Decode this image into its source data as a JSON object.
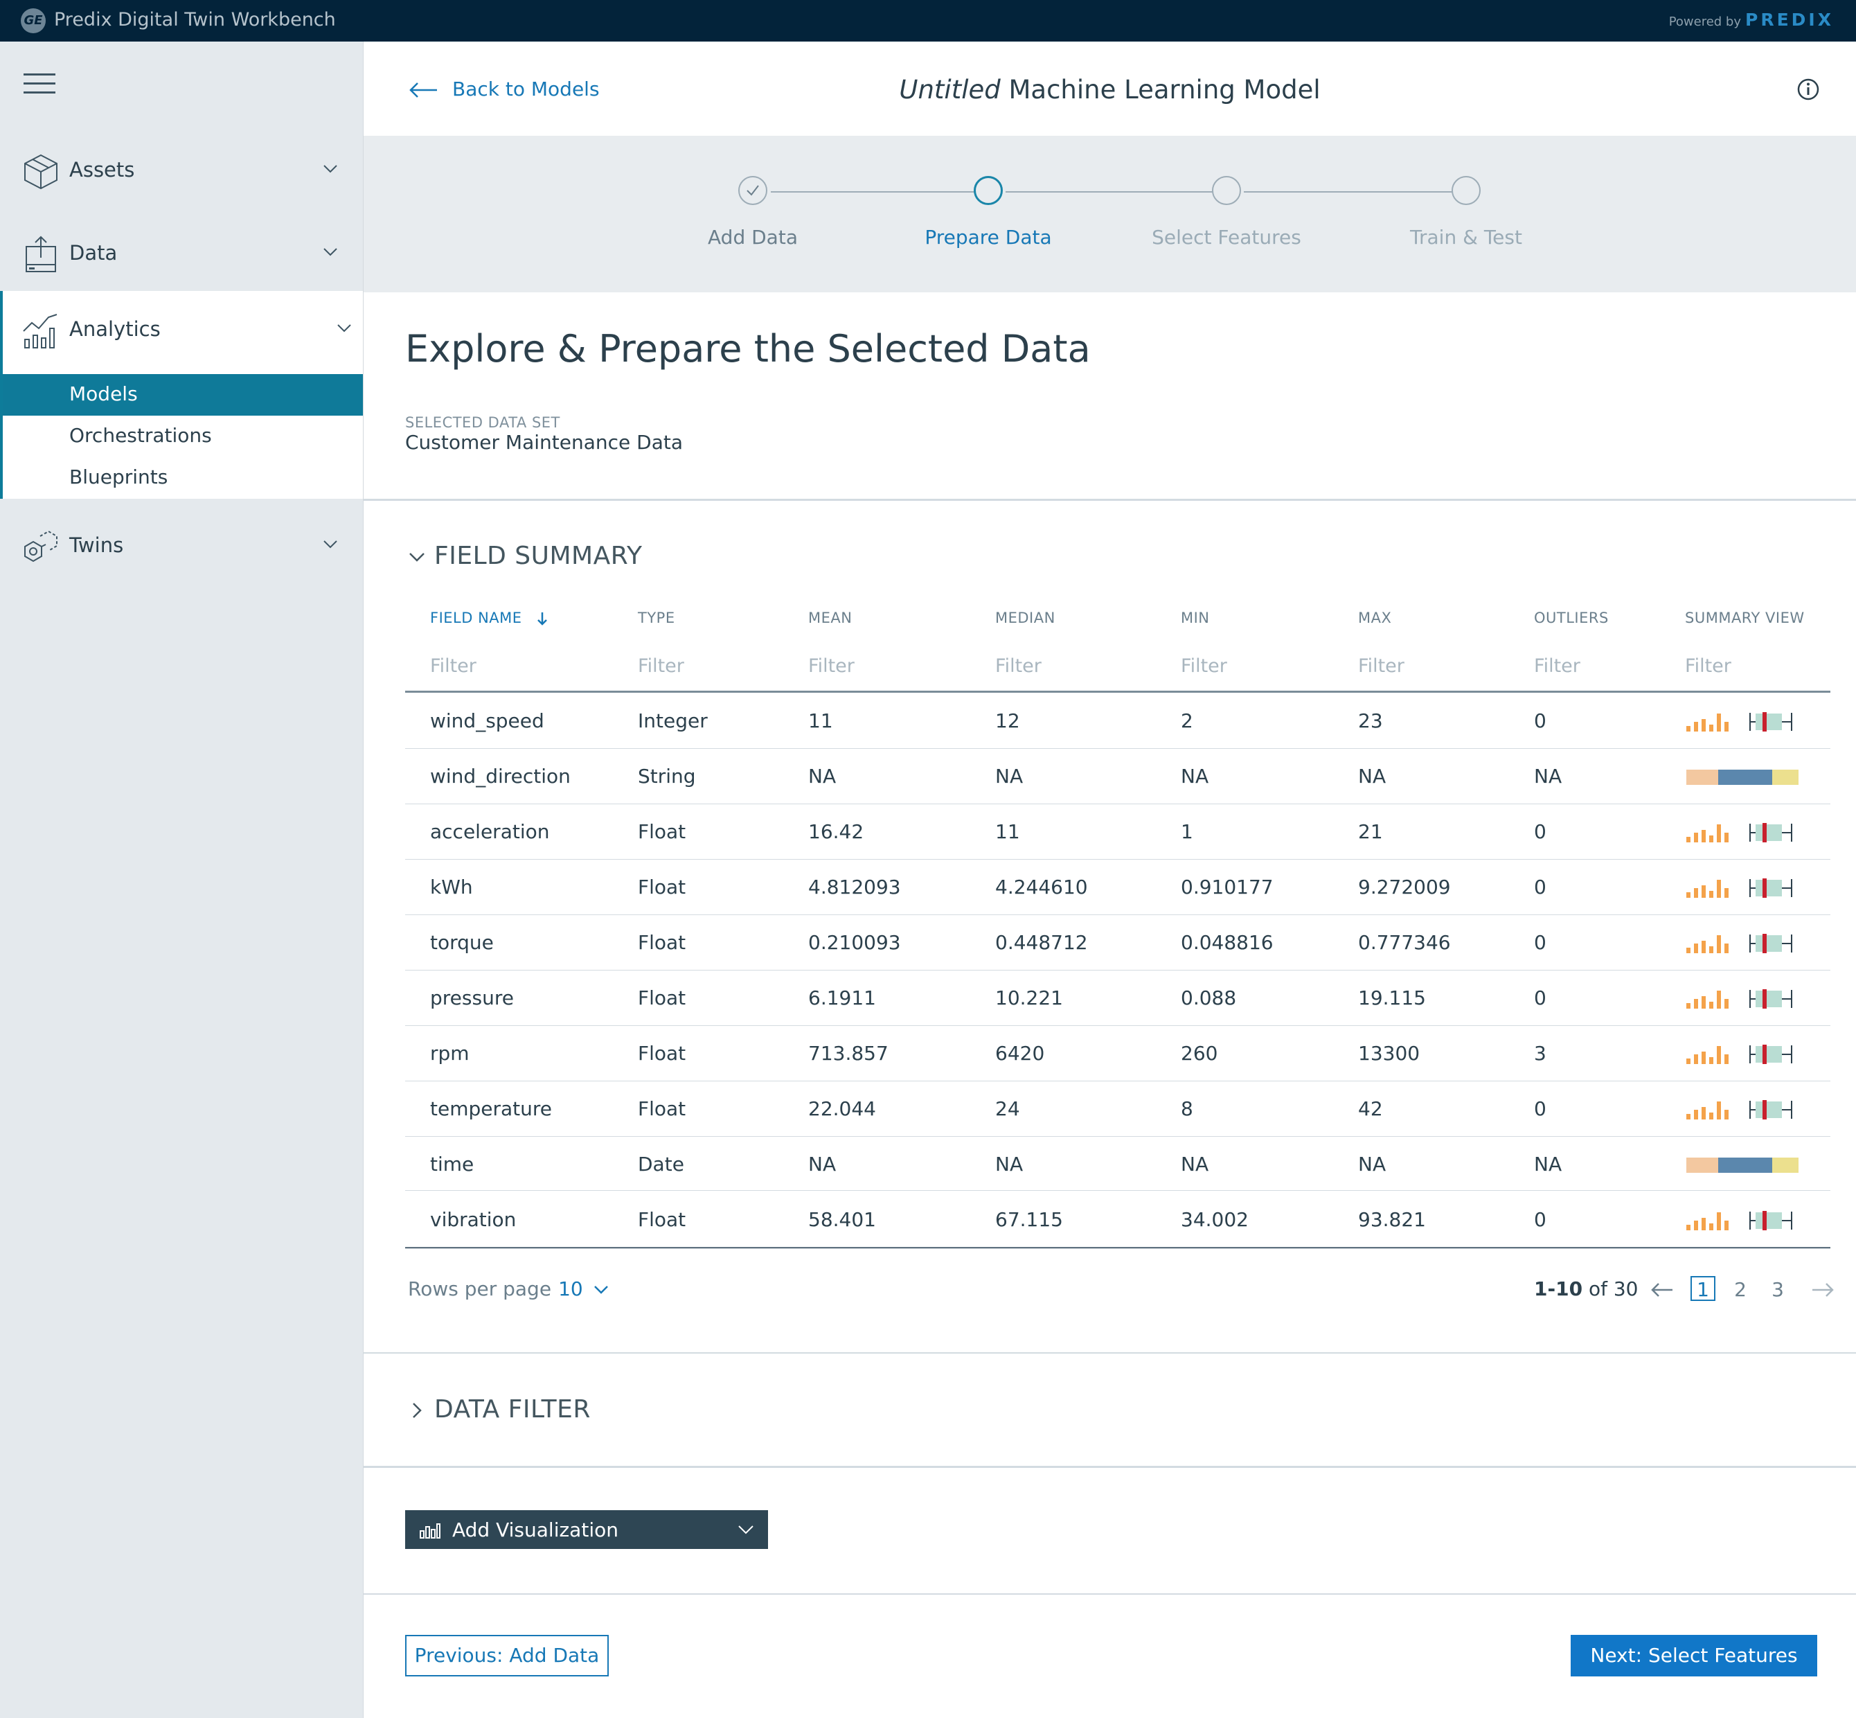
{
  "app": {
    "title": "Predix Digital Twin Workbench",
    "powered_by": "Powered by",
    "brand": "PREDIX",
    "logo_text": "GE"
  },
  "sidebar": {
    "items": [
      {
        "label": "Assets",
        "icon": "cube-icon"
      },
      {
        "label": "Data",
        "icon": "data-upload-icon"
      },
      {
        "label": "Analytics",
        "icon": "analytics-chart-icon"
      },
      {
        "label": "Twins",
        "icon": "hexagon-network-icon"
      }
    ],
    "analytics_sub": [
      {
        "label": "Models",
        "active": true
      },
      {
        "label": "Orchestrations",
        "active": false
      },
      {
        "label": "Blueprints",
        "active": false
      }
    ]
  },
  "header": {
    "back_label": "Back to Models",
    "title_italic": "Untitled",
    "title_rest": " Machine Learning Model"
  },
  "stepper": {
    "steps": [
      {
        "label": "Add Data",
        "state": "done"
      },
      {
        "label": "Prepare Data",
        "state": "active"
      },
      {
        "label": "Select Features",
        "state": "pending"
      },
      {
        "label": "Train & Test",
        "state": "pending"
      }
    ]
  },
  "page": {
    "heading": "Explore & Prepare the Selected Data",
    "dataset_caption": "SELECTED DATA SET",
    "dataset_name": "Customer Maintenance Data"
  },
  "field_summary": {
    "title": "FIELD SUMMARY",
    "columns": [
      "FIELD NAME",
      "TYPE",
      "MEAN",
      "MEDIAN",
      "MIN",
      "MAX",
      "OUTLIERS",
      "SUMMARY VIEW"
    ],
    "filter_placeholder": "Filter",
    "rows": [
      {
        "name": "wind_speed",
        "type": "Integer",
        "mean": "11",
        "median": "12",
        "min": "2",
        "max": "23",
        "outliers": "0",
        "view": "numeric"
      },
      {
        "name": "wind_direction",
        "type": "String",
        "mean": "NA",
        "median": "NA",
        "min": "NA",
        "max": "NA",
        "outliers": "NA",
        "view": "categorical"
      },
      {
        "name": "acceleration",
        "type": "Float",
        "mean": "16.42",
        "median": "11",
        "min": "1",
        "max": "21",
        "outliers": "0",
        "view": "numeric"
      },
      {
        "name": "kWh",
        "type": "Float",
        "mean": "4.812093",
        "median": "4.244610",
        "min": "0.910177",
        "max": "9.272009",
        "outliers": "0",
        "view": "numeric"
      },
      {
        "name": "torque",
        "type": "Float",
        "mean": "0.210093",
        "median": "0.448712",
        "min": "0.048816",
        "max": "0.777346",
        "outliers": "0",
        "view": "numeric"
      },
      {
        "name": "pressure",
        "type": "Float",
        "mean": "6.1911",
        "median": "10.221",
        "min": "0.088",
        "max": "19.115",
        "outliers": "0",
        "view": "numeric"
      },
      {
        "name": "rpm",
        "type": "Float",
        "mean": "713.857",
        "median": "6420",
        "min": "260",
        "max": "13300",
        "outliers": "3",
        "view": "numeric"
      },
      {
        "name": "temperature",
        "type": "Float",
        "mean": "22.044",
        "median": "24",
        "min": "8",
        "max": "42",
        "outliers": "0",
        "view": "numeric"
      },
      {
        "name": "time",
        "type": "Date",
        "mean": "NA",
        "median": "NA",
        "min": "NA",
        "max": "NA",
        "outliers": "NA",
        "view": "categorical"
      },
      {
        "name": "vibration",
        "type": "Float",
        "mean": "58.401",
        "median": "67.115",
        "min": "34.002",
        "max": "93.821",
        "outliers": "0",
        "view": "numeric"
      }
    ],
    "colors": {
      "histogram": "#f4a24a",
      "box_fill": "#b9ddd3",
      "box_median": "#c8202d",
      "whisker": "#2c404c",
      "cat_left": "#f3c8a0",
      "cat_mid": "#5b87ad",
      "cat_right": "#ece08e"
    }
  },
  "pagination": {
    "rows_per_page_label": "Rows per page",
    "rows_per_page_value": "10",
    "range_bold": "1-10",
    "range_rest": " of 30",
    "pages": [
      "1",
      "2",
      "3"
    ],
    "current_page": "1"
  },
  "data_filter": {
    "title": "DATA FILTER"
  },
  "visualization": {
    "label": "Add Visualization"
  },
  "footer": {
    "previous_label": "Previous: Add Data",
    "next_label": "Next: Select Features"
  },
  "colors": {
    "topbar": "#03233a",
    "accent": "#1778b6",
    "active_nav": "#0f7a99",
    "primary_button": "#1177c8"
  }
}
